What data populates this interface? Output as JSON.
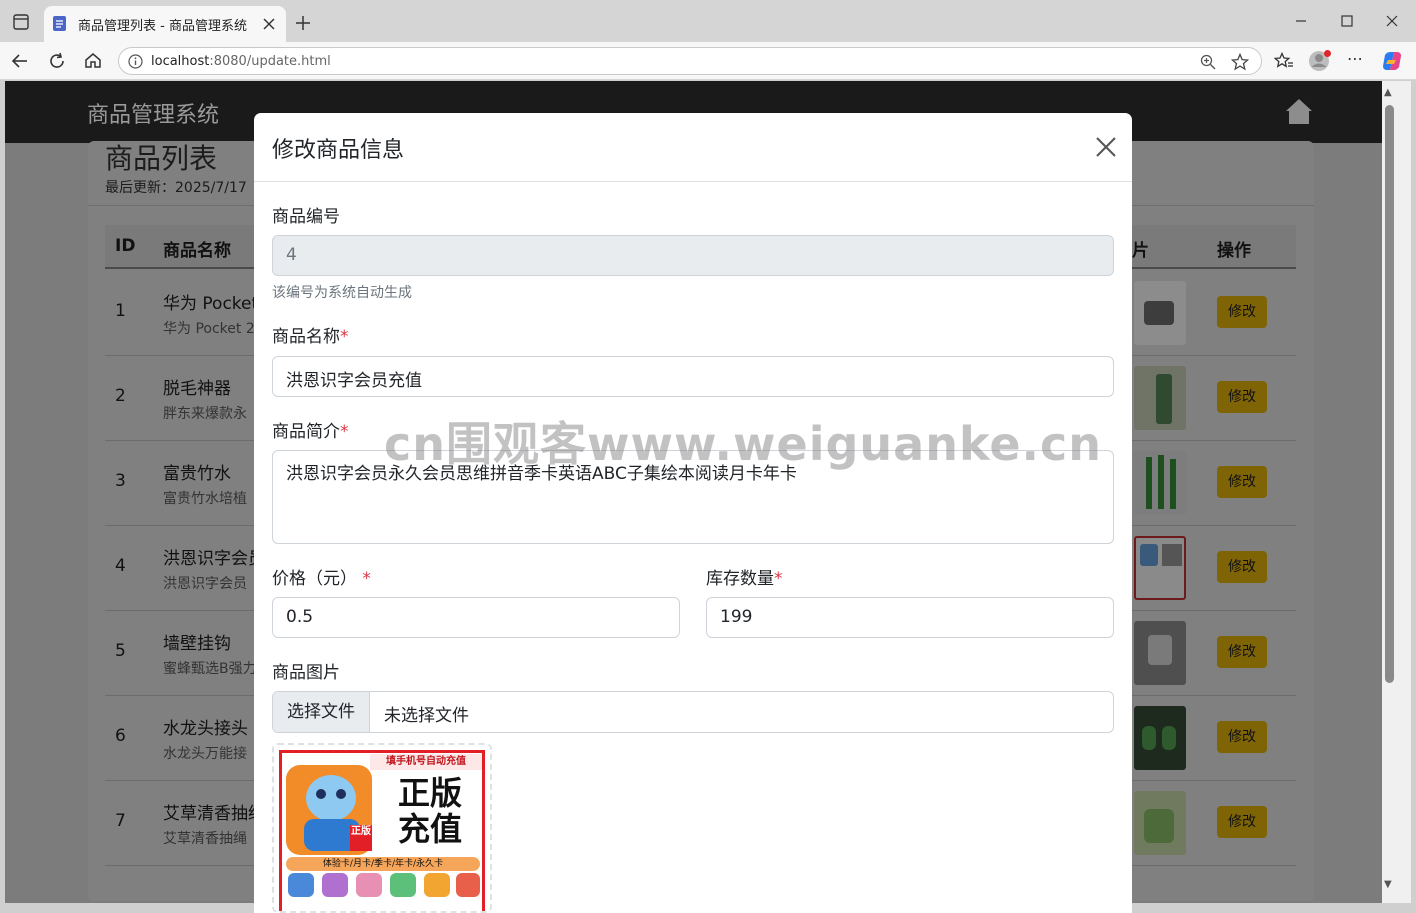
{
  "browser": {
    "tab_title": "商品管理列表 - 商品管理系统",
    "url_host": "localhost",
    "url_rest": ":8080/update.html"
  },
  "navbar": {
    "brand": "商品管理系统"
  },
  "list": {
    "title": "商品列表",
    "last_updated": "最后更新：2025/7/17",
    "columns": {
      "id": "ID",
      "name": "商品名称",
      "image": "片",
      "actions": "操作"
    },
    "edit_label": "修改",
    "rows": [
      {
        "id": "1",
        "name": "华为 Pocket",
        "desc": "华为 Pocket 2"
      },
      {
        "id": "2",
        "name": "脱毛神器",
        "desc": "胖东来爆款永"
      },
      {
        "id": "3",
        "name": "富贵竹水",
        "desc": "富贵竹水培植"
      },
      {
        "id": "4",
        "name": "洪恩识字会员",
        "desc": "洪恩识字会员"
      },
      {
        "id": "5",
        "name": "墙壁挂钩",
        "desc": "蜜蜂甄选B强力"
      },
      {
        "id": "6",
        "name": "水龙头接头",
        "desc": "水龙头万能接"
      },
      {
        "id": "7",
        "name": "艾草清香抽绳",
        "desc": "艾草清香抽绳"
      }
    ]
  },
  "modal": {
    "title": "修改商品信息",
    "id_label": "商品编号",
    "id_value": "4",
    "id_help": "该编号为系统自动生成",
    "name_label": "商品名称",
    "name_value": "洪恩识字会员充值",
    "desc_label": "商品简介",
    "desc_value": "洪恩识字会员永久会员思维拼音季卡英语ABC子集绘本阅读月卡年卡",
    "price_label": "价格（元）",
    "price_value": "0.5",
    "stock_label": "库存数量",
    "stock_value": "199",
    "image_label": "商品图片",
    "file_button": "选择文件",
    "file_status": "未选择文件",
    "required_mark": "*",
    "preview": {
      "banner": "填手机号自动充值",
      "line1": "正版",
      "line2": "充值",
      "badge": "正版",
      "strip": "体验卡/月卡/季卡/年卡/永久卡"
    }
  },
  "watermark": "cn围观客www.weiguanke.cn",
  "colors": {
    "modal_bg": "#ffffff",
    "overlay": "#7c7c7c",
    "edit_button": "#ffc107",
    "required": "#dc3545"
  }
}
